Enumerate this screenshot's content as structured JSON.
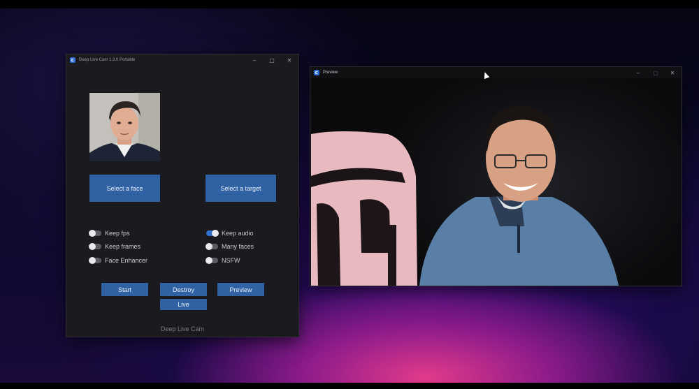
{
  "app_window": {
    "title": "Deep Live Cam 1.3.0 Portable",
    "select_face_label": "Select a face",
    "select_target_label": "Select a target",
    "toggles": {
      "keep_fps": {
        "label": "Keep fps",
        "on": false
      },
      "keep_frames": {
        "label": "Keep frames",
        "on": false
      },
      "face_enhancer": {
        "label": "Face Enhancer",
        "on": false
      },
      "keep_audio": {
        "label": "Keep audio",
        "on": true
      },
      "many_faces": {
        "label": "Many faces",
        "on": false
      },
      "nsfw": {
        "label": "NSFW",
        "on": false
      }
    },
    "start_label": "Start",
    "destroy_label": "Destroy",
    "preview_label": "Preview",
    "live_label": "Live",
    "footer": "Deep Live Cam"
  },
  "preview_window": {
    "title": "Preview"
  },
  "window_controls": {
    "minimize": "–",
    "maximize": "▢",
    "close": "✕"
  },
  "colors": {
    "accent_button": "#2f61a3",
    "toggle_on": "#2f6fd0",
    "window_bg": "#1b1b1f"
  }
}
